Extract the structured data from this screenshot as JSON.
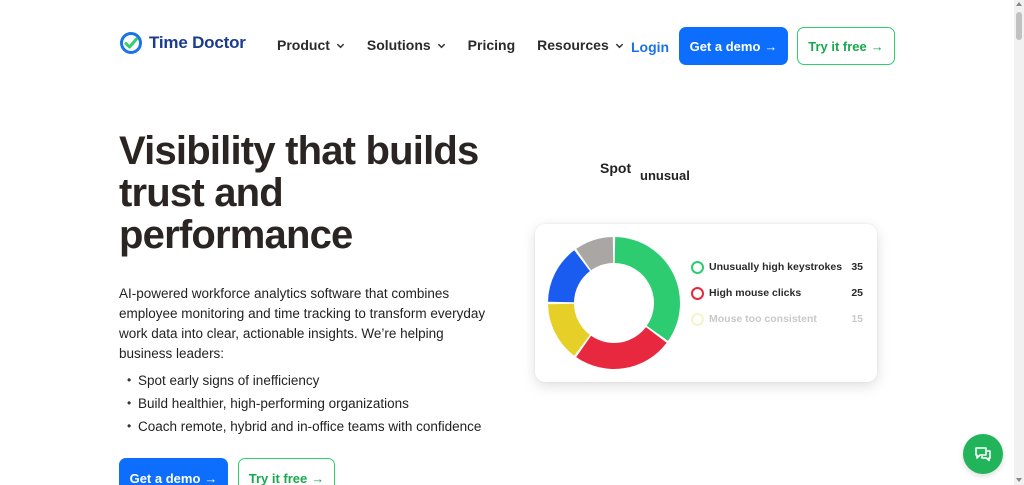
{
  "brand": {
    "name": "Time Doctor",
    "color": "#1a3b8f",
    "accent": "#2fcf6a"
  },
  "nav": {
    "items": [
      {
        "label": "Product",
        "dropdown": true
      },
      {
        "label": "Solutions",
        "dropdown": true
      },
      {
        "label": "Pricing",
        "dropdown": false
      },
      {
        "label": "Resources",
        "dropdown": true
      }
    ],
    "login": "Login",
    "demo": "Get a demo",
    "try": "Try it free",
    "arrow": "→"
  },
  "hero": {
    "title": "Visibility that builds trust and performance",
    "description": "AI-powered workforce analytics software that combines employee monitoring and time tracking to transform everyday work data into clear, actionable insights. We’re helping business leaders:",
    "bullets": [
      "Spot early signs of inefficiency",
      "Build healthier, high-performing organizations",
      "Coach remote, hybrid and in-office teams with confidence"
    ],
    "demo": "Get a demo",
    "try": "Try it free"
  },
  "animated_heading": {
    "word1": "Spot",
    "word2": "unusual"
  },
  "chart_data": {
    "type": "pie",
    "segments": [
      {
        "name": "Unusually high keystrokes",
        "value": 35,
        "color": "#2ecc71",
        "dim": false
      },
      {
        "name": "High mouse clicks",
        "value": 25,
        "color": "#e8283f",
        "dim": false
      },
      {
        "name": "Mouse too consistent",
        "value": 15,
        "color": "#e6cf27",
        "dim": true
      },
      {
        "name": "",
        "value": 15,
        "color": "#1a5cf0",
        "dim": false
      },
      {
        "name": "",
        "value": 10,
        "color": "#a9a6a3",
        "dim": false
      }
    ]
  },
  "colors": {
    "primary": "#0d6efd",
    "chat": "#22b45a"
  },
  "icons": {
    "logo": "clock-check-icon",
    "chat": "chat-bubble-icon",
    "chevron": "chevron-down-icon"
  }
}
